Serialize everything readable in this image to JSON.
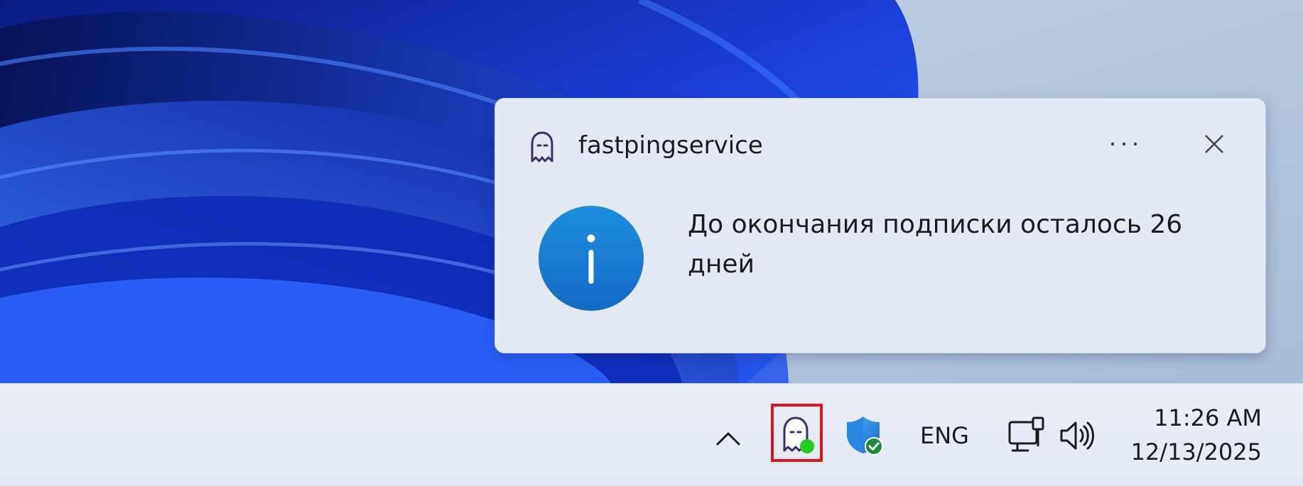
{
  "notification": {
    "app_name": "fastpingservice",
    "message": "До окончания подписки осталось 26 дней",
    "app_icon": "ghost-icon",
    "more_icon": "more-options-icon",
    "close_icon": "close-icon",
    "body_icon": "info-icon"
  },
  "taskbar": {
    "tray": {
      "overflow_icon": "chevron-up-icon",
      "app_icon": "ghost-icon",
      "app_status_color": "#22cc22",
      "highlight_color": "#e0141e",
      "security_icon": "windows-security-icon",
      "language": "ENG",
      "network_icon": "ethernet-icon",
      "volume_icon": "speaker-icon"
    },
    "clock": {
      "time": "11:26 AM",
      "date": "12/13/2025"
    }
  },
  "colors": {
    "accent_blue": "#1a7fd4",
    "wallpaper_blue": "#1a3fd8",
    "toast_bg": "#e3e9f5",
    "taskbar_bg": "#e9eef7"
  }
}
